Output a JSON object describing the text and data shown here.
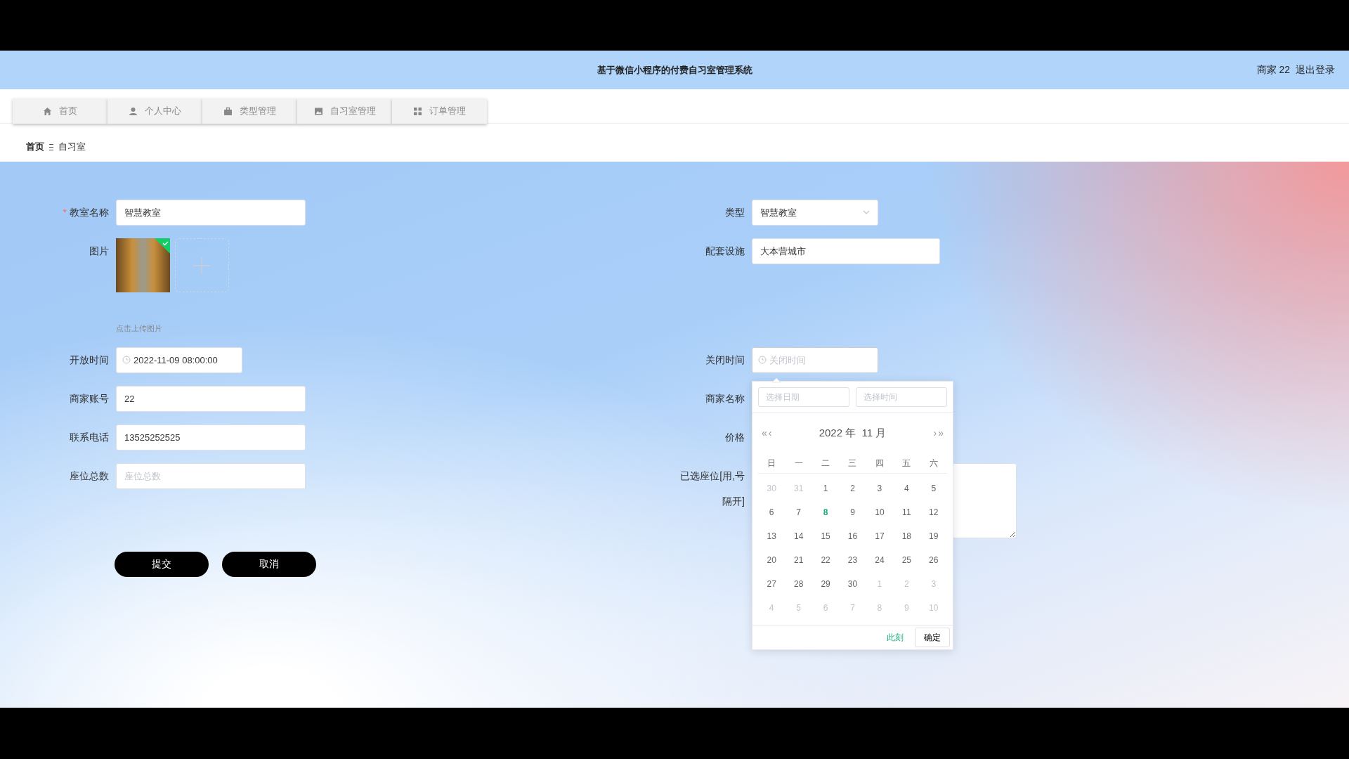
{
  "header": {
    "title": "基于微信小程序的付费自习室管理系统",
    "user": "商家 22",
    "logout": "退出登录"
  },
  "nav": [
    {
      "label": "首页"
    },
    {
      "label": "个人中心"
    },
    {
      "label": "类型管理"
    },
    {
      "label": "自习室管理"
    },
    {
      "label": "订单管理"
    }
  ],
  "breadcrumb": [
    "首页",
    "自习室"
  ],
  "form": {
    "left": [
      {
        "kind": "text",
        "label": "教室名称",
        "required_mark": "*",
        "value": "智慧教室"
      },
      {
        "kind": "image",
        "label": "图片",
        "hint": "点击上传图片"
      },
      {
        "kind": "datetime",
        "label": "开放时间",
        "value": "2022-11-09 08:00:00"
      },
      {
        "kind": "text",
        "label": "商家账号",
        "value": "22"
      },
      {
        "kind": "text",
        "label": "联系电话",
        "value": "13525252525"
      },
      {
        "kind": "text",
        "label": "座位总数",
        "placeholder": "座位总数"
      }
    ],
    "right": [
      {
        "kind": "select",
        "label": "类型",
        "value": "智慧教室"
      },
      {
        "kind": "wide",
        "label": "配套设施",
        "value": "大本营城市"
      },
      {
        "kind": "datetime",
        "label": "关闭时间",
        "placeholder": "关闭时间",
        "open": true
      },
      {
        "kind": "covered",
        "label": "商家名称"
      },
      {
        "kind": "covered",
        "label": "价格"
      },
      {
        "kind": "textarea",
        "label": "已选座位[用,号隔开]"
      }
    ],
    "buttons": [
      "提交",
      "取消"
    ]
  },
  "calendar": {
    "date_placeholder": "选择日期",
    "time_placeholder": "选择时间",
    "prev_year": "«",
    "prev_month": "‹",
    "title": "2022 年  11 月",
    "next_month": "›",
    "next_year": "»",
    "weekdays": [
      "日",
      "一",
      "二",
      "三",
      "四",
      "五",
      "六"
    ],
    "days": [
      {
        "label": "30",
        "muted": true,
        "today": false
      },
      {
        "label": "31",
        "muted": true,
        "today": false
      },
      {
        "label": "1",
        "muted": false,
        "today": false
      },
      {
        "label": "2",
        "muted": false,
        "today": false
      },
      {
        "label": "3",
        "muted": false,
        "today": false
      },
      {
        "label": "4",
        "muted": false,
        "today": false
      },
      {
        "label": "5",
        "muted": false,
        "today": false
      },
      {
        "label": "6",
        "muted": false,
        "today": false
      },
      {
        "label": "7",
        "muted": false,
        "today": false
      },
      {
        "label": "8",
        "muted": false,
        "today": true
      },
      {
        "label": "9",
        "muted": false,
        "today": false
      },
      {
        "label": "10",
        "muted": false,
        "today": false
      },
      {
        "label": "11",
        "muted": false,
        "today": false
      },
      {
        "label": "12",
        "muted": false,
        "today": false
      },
      {
        "label": "13",
        "muted": false,
        "today": false
      },
      {
        "label": "14",
        "muted": false,
        "today": false
      },
      {
        "label": "15",
        "muted": false,
        "today": false
      },
      {
        "label": "16",
        "muted": false,
        "today": false
      },
      {
        "label": "17",
        "muted": false,
        "today": false
      },
      {
        "label": "18",
        "muted": false,
        "today": false
      },
      {
        "label": "19",
        "muted": false,
        "today": false
      },
      {
        "label": "20",
        "muted": false,
        "today": false
      },
      {
        "label": "21",
        "muted": false,
        "today": false
      },
      {
        "label": "22",
        "muted": false,
        "today": false
      },
      {
        "label": "23",
        "muted": false,
        "today": false
      },
      {
        "label": "24",
        "muted": false,
        "today": false
      },
      {
        "label": "25",
        "muted": false,
        "today": false
      },
      {
        "label": "26",
        "muted": false,
        "today": false
      },
      {
        "label": "27",
        "muted": false,
        "today": false
      },
      {
        "label": "28",
        "muted": false,
        "today": false
      },
      {
        "label": "29",
        "muted": false,
        "today": false
      },
      {
        "label": "30",
        "muted": false,
        "today": false
      },
      {
        "label": "1",
        "muted": true,
        "today": false
      },
      {
        "label": "2",
        "muted": true,
        "today": false
      },
      {
        "label": "3",
        "muted": true,
        "today": false
      },
      {
        "label": "4",
        "muted": true,
        "today": false
      },
      {
        "label": "5",
        "muted": true,
        "today": false
      },
      {
        "label": "6",
        "muted": true,
        "today": false
      },
      {
        "label": "7",
        "muted": true,
        "today": false
      },
      {
        "label": "8",
        "muted": true,
        "today": false
      },
      {
        "label": "9",
        "muted": true,
        "today": false
      },
      {
        "label": "10",
        "muted": true,
        "today": false
      }
    ],
    "now_label": "此刻",
    "confirm": "确定"
  }
}
